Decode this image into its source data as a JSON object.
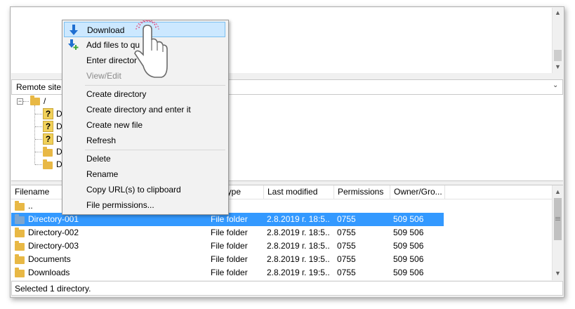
{
  "remote_site": {
    "label": "Remote site:",
    "dropdown_arrow": "chevron-down"
  },
  "tree": {
    "root": "/",
    "children": [
      "D",
      "D",
      "D",
      "D",
      "D"
    ]
  },
  "file_list": {
    "columns": [
      "Filename",
      "Filetype",
      "Last modified",
      "Permissions",
      "Owner/Gro..."
    ],
    "rows": [
      {
        "name": "..",
        "type": "",
        "modified": "",
        "perms": "",
        "owner": ""
      },
      {
        "name": "Directory-001",
        "type": "File folder",
        "modified": "2.8.2019 г. 18:5...",
        "perms": "0755",
        "owner": "509 506"
      },
      {
        "name": "Directory-002",
        "type": "File folder",
        "modified": "2.8.2019 г. 18:5...",
        "perms": "0755",
        "owner": "509 506"
      },
      {
        "name": "Directory-003",
        "type": "File folder",
        "modified": "2.8.2019 г. 18:5...",
        "perms": "0755",
        "owner": "509 506"
      },
      {
        "name": "Documents",
        "type": "File folder",
        "modified": "2.8.2019 г. 19:5...",
        "perms": "0755",
        "owner": "509 506"
      },
      {
        "name": "Downloads",
        "type": "File folder",
        "modified": "2.8.2019 г. 19:5...",
        "perms": "0755",
        "owner": "509 506"
      }
    ],
    "selected_row": 1
  },
  "context_menu": {
    "download": "Download",
    "add_to_queue": "Add files to qu",
    "enter_directory": "Enter director",
    "view_edit": "View/Edit",
    "create_directory": "Create directory",
    "create_directory_enter": "Create directory and enter it",
    "create_new_file": "Create new file",
    "refresh": "Refresh",
    "delete": "Delete",
    "rename": "Rename",
    "copy_url": "Copy URL(s) to clipboard",
    "file_permissions": "File permissions..."
  },
  "status_bar": {
    "text": "Selected 1 directory."
  },
  "colors": {
    "selection": "#3399ff",
    "menu_highlight": "#cce8ff",
    "folder": "#e8b845"
  }
}
